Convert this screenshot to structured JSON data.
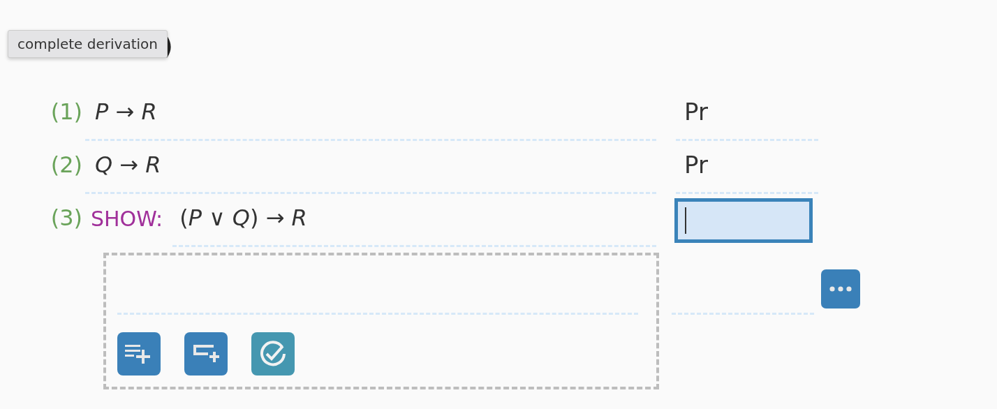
{
  "heading": {
    "visible_text": ")"
  },
  "tooltip": {
    "text": "complete derivation"
  },
  "lines": [
    {
      "kind": "premise",
      "number": "(1)",
      "formula": "*P* → *R*",
      "justification": "Pr"
    },
    {
      "kind": "premise",
      "number": "(2)",
      "formula": "*Q* → *R*",
      "justification": "Pr"
    },
    {
      "kind": "show",
      "number": "(3)",
      "label": "SHOW:",
      "formula": "(*P* ∨ *Q*) → *R*",
      "focused": true
    }
  ],
  "subderivation": {
    "lines": [
      {
        "kind": "empty"
      }
    ],
    "tools": [
      {
        "kind": "add-line"
      },
      {
        "kind": "add-subderivation"
      },
      {
        "kind": "check"
      }
    ]
  },
  "more_button": {
    "kind": "dots"
  }
}
